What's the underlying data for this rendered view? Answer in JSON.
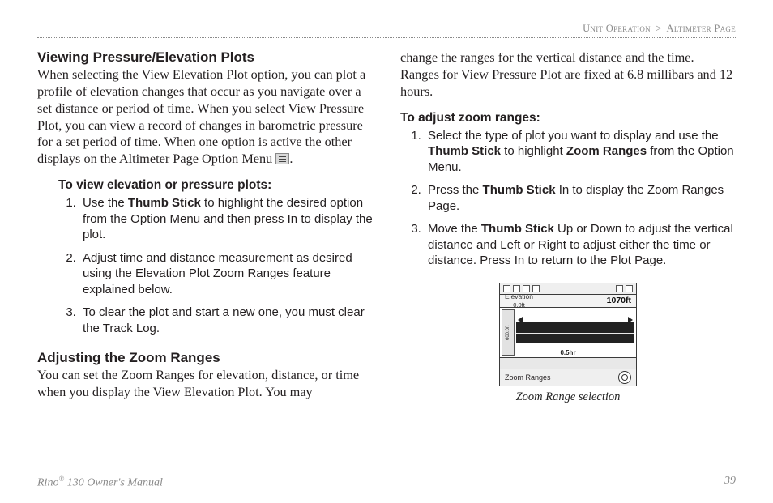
{
  "breadcrumb": {
    "section": "Unit Operation",
    "page": "Altimeter Page",
    "sep": ">"
  },
  "left": {
    "h_viewing": "Viewing Pressure/Elevation Plots",
    "p_viewing": "When selecting the View Elevation Plot option, you can plot a profile of elevation changes that occur as you navigate over a set distance or period of time. When you select View Pressure Plot, you can view a record of changes in barometric pressure for a set period of time. When one option is active the other displays on the Altimeter Page Option Menu ",
    "p_viewing_end": ".",
    "h_toview": "To view elevation or pressure plots:",
    "steps_view": {
      "s1a": "Use the ",
      "s1b": "Thumb Stick",
      "s1c": " to highlight the desired option from the Option Menu and then press In to display the plot.",
      "s2": "Adjust time and distance measurement as desired using the Elevation Plot Zoom Ranges feature explained below.",
      "s3": "To clear the plot and start a new one, you must clear the Track Log."
    },
    "h_adjust": "Adjusting the Zoom Ranges",
    "p_adjust": "You can set the Zoom Ranges for elevation, distance, or time when you display the View Elevation Plot. You may"
  },
  "right": {
    "p_cont": "change the ranges for the vertical distance and the time. Ranges for View Pressure Plot are fixed at 6.8 millibars and 12 hours.",
    "h_toadjust": "To adjust zoom ranges:",
    "steps_adjust": {
      "s1a": "Select the type of plot you want to display and use the ",
      "s1b": "Thumb Stick",
      "s1c": " to highlight ",
      "s1d": "Zoom Ranges",
      "s1e": " from the Option Menu.",
      "s2a": "Press the ",
      "s2b": "Thumb Stick",
      "s2c": " In to display the Zoom Ranges Page.",
      "s3a": "Move the ",
      "s3b": "Thumb Stick",
      "s3c": " Up or Down to adjust the vertical distance and Left or Right to adjust either the time or distance. Press In to return to the Plot Page."
    },
    "device": {
      "elev_label": "Elevation",
      "elev_sub": "0.0ft",
      "elev_value": "1070ft",
      "yaxis": "600.0ft",
      "xaxis": "0.5hr",
      "footer_label": "Zoom Ranges"
    },
    "caption": "Zoom Range selection"
  },
  "footer": {
    "left_a": "Rino",
    "left_sup": "®",
    "left_b": " 130 Owner's Manual",
    "pageno": "39"
  }
}
